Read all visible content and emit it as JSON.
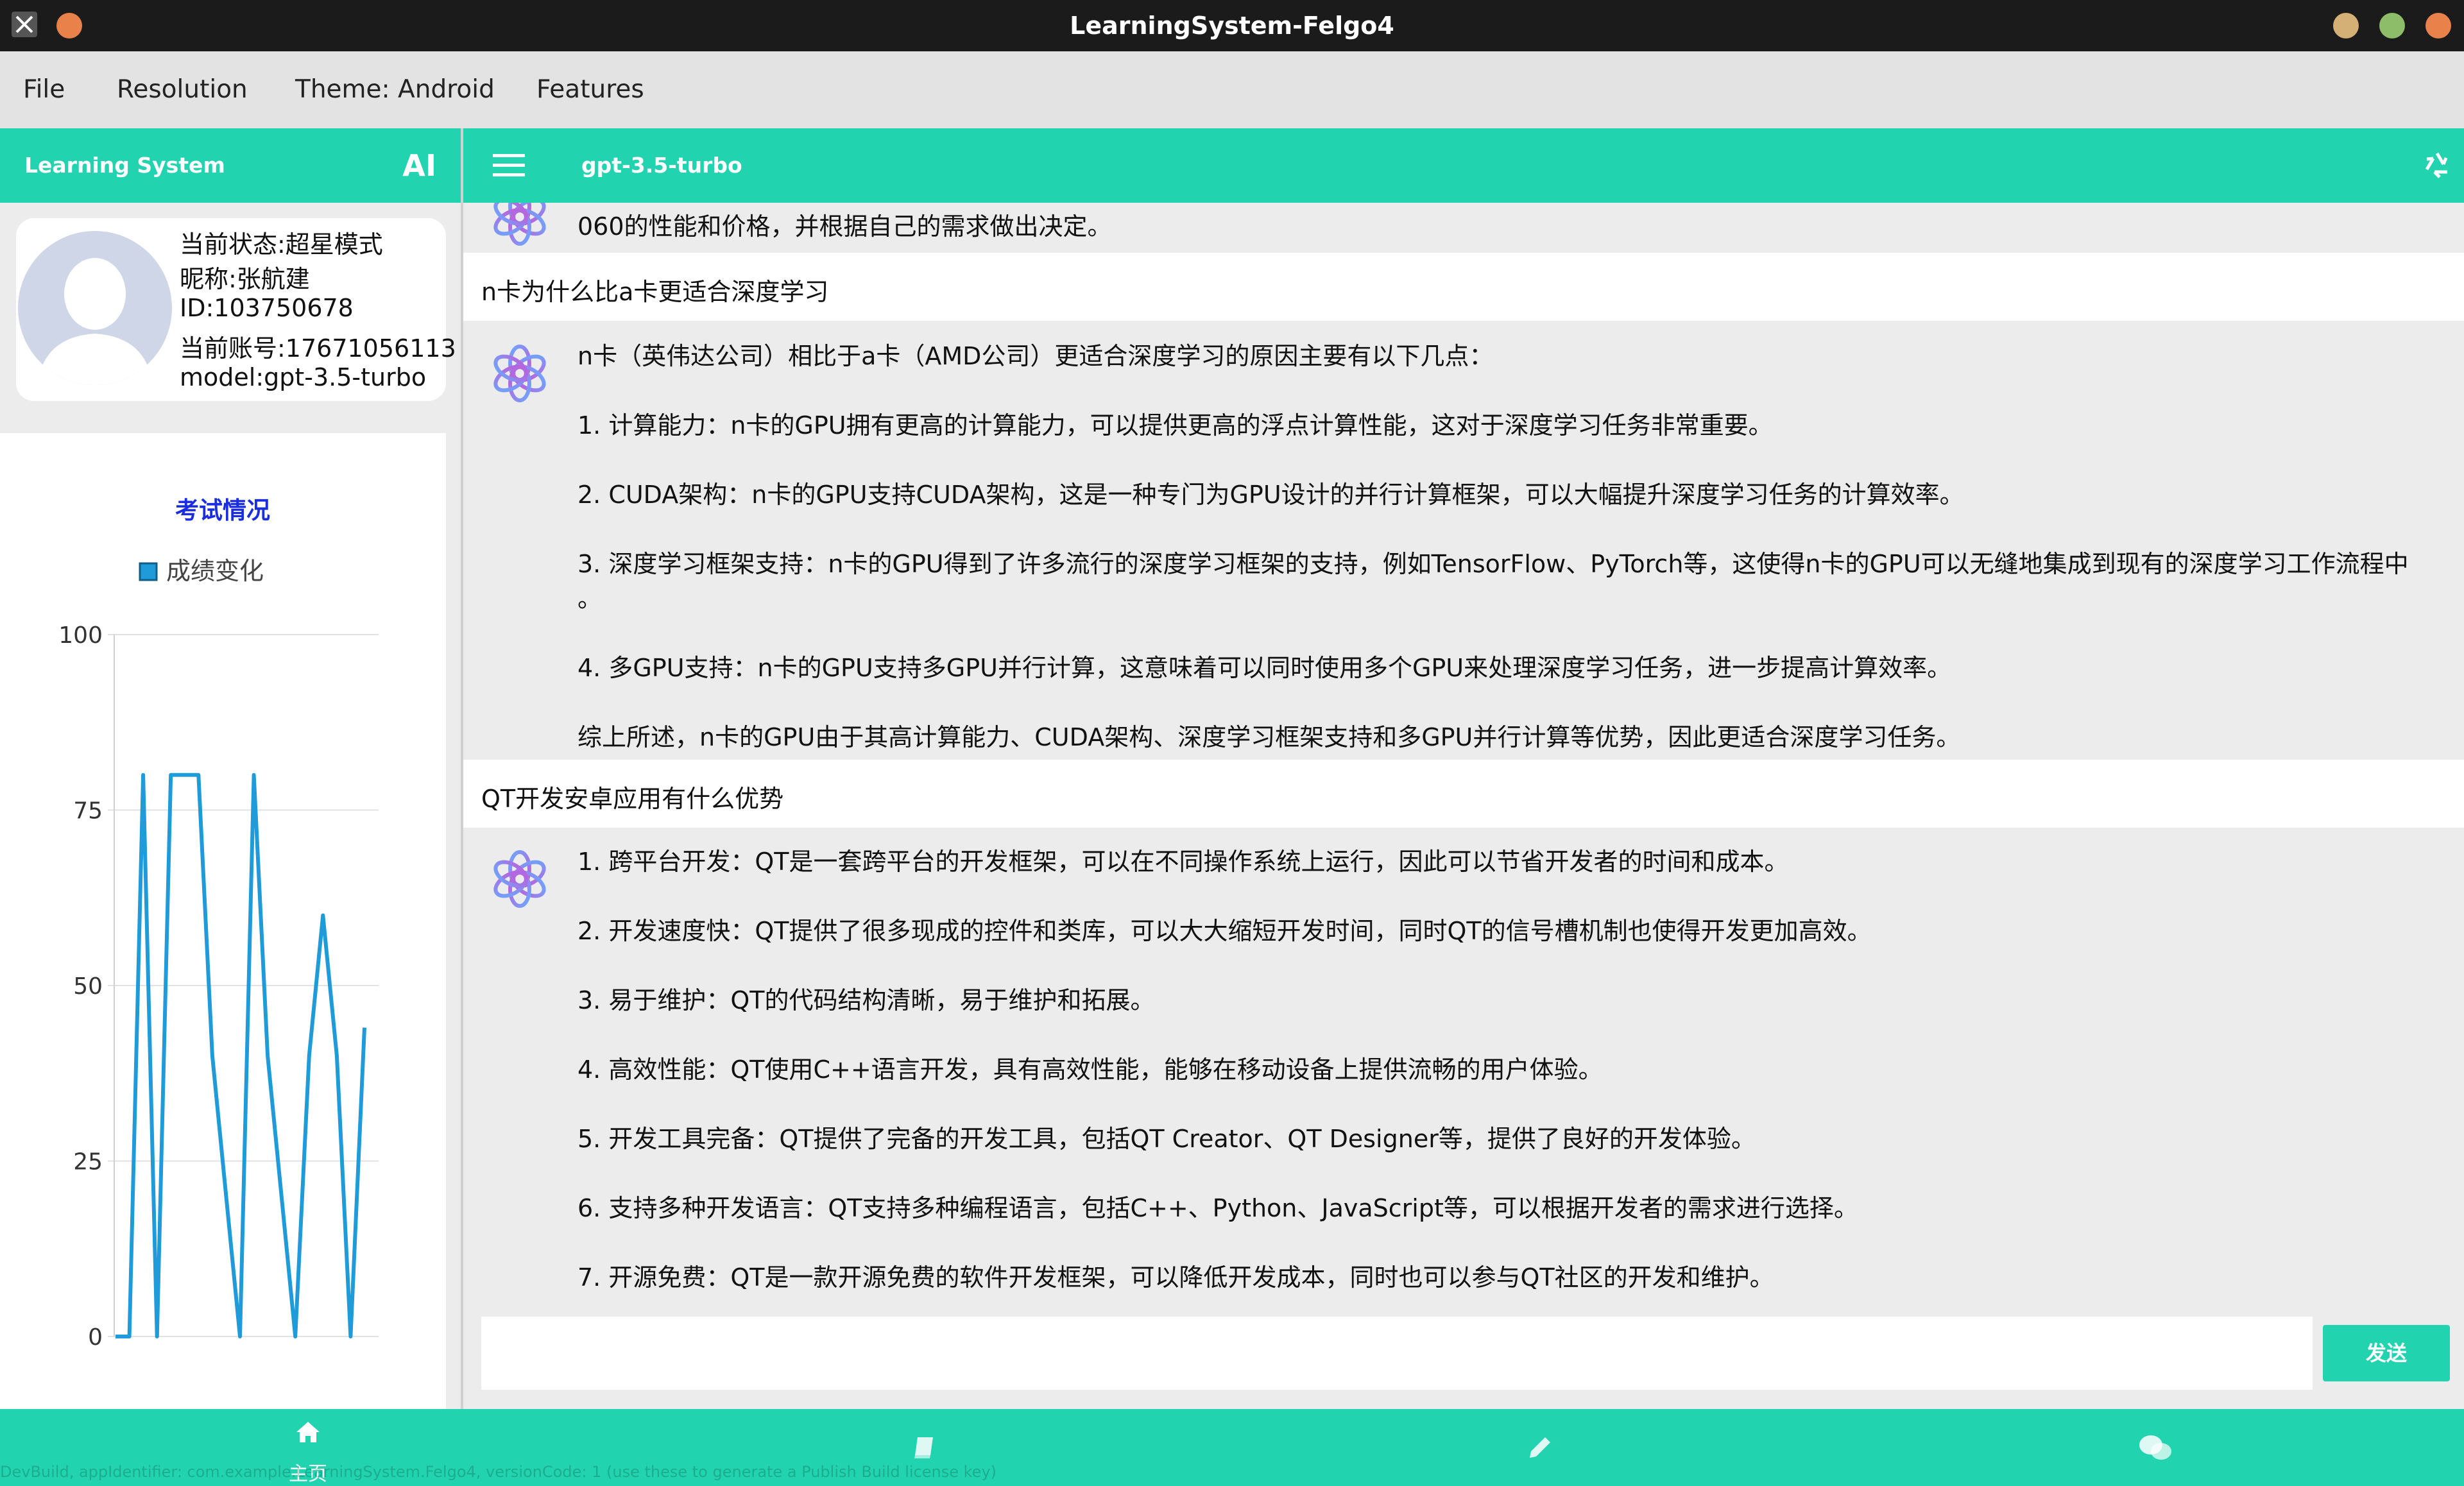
{
  "window": {
    "title": "LearningSystem-Felgo4"
  },
  "menu": {
    "file": "File",
    "resolution": "Resolution",
    "theme": "Theme: Android",
    "features": "Features"
  },
  "sidebar": {
    "app_title": "Learning System",
    "ai_label": "AI"
  },
  "main_toolbar": {
    "model_title": "gpt-3.5-turbo"
  },
  "profile": {
    "status": "当前状态:超星模式",
    "nickname": "昵称:张航建",
    "id": "ID:103750678",
    "account": "当前账号:17671056113",
    "model": "model:gpt-3.5-turbo"
  },
  "chart_data": {
    "type": "line",
    "title": "考试情况",
    "legend": [
      "成绩变化"
    ],
    "series": [
      {
        "name": "成绩变化",
        "color": "#1e9bd8",
        "values": [
          0,
          0,
          80,
          0,
          80,
          80,
          80,
          40,
          20,
          0,
          80,
          40,
          20,
          0,
          40,
          60,
          40,
          0,
          44
        ]
      }
    ],
    "yticks": [
      "100",
      "75",
      "50",
      "25",
      "0"
    ],
    "ylim": [
      0,
      100
    ],
    "grid": true,
    "legend_position": "top"
  },
  "chat": {
    "messages": [
      {
        "role": "assistant",
        "lines": [
          "060的性能和价格，并根据自己的需求做出决定。"
        ]
      },
      {
        "role": "user",
        "text": "n卡为什么比a卡更适合深度学习"
      },
      {
        "role": "assistant",
        "lines": [
          "n卡（英伟达公司）相比于a卡（AMD公司）更适合深度学习的原因主要有以下几点：",
          "1. 计算能力：n卡的GPU拥有更高的计算能力，可以提供更高的浮点计算性能，这对于深度学习任务非常重要。",
          "2. CUDA架构：n卡的GPU支持CUDA架构，这是一种专门为GPU设计的并行计算框架，可以大幅提升深度学习任务的计算效率。",
          "3. 深度学习框架支持：n卡的GPU得到了许多流行的深度学习框架的支持，例如TensorFlow、PyTorch等，这使得n卡的GPU可以无缝地集成到现有的深度学习工作流程中",
          "。",
          "4. 多GPU支持：n卡的GPU支持多GPU并行计算，这意味着可以同时使用多个GPU来处理深度学习任务，进一步提高计算效率。",
          "综上所述，n卡的GPU由于其高计算能力、CUDA架构、深度学习框架支持和多GPU并行计算等优势，因此更适合深度学习任务。"
        ]
      },
      {
        "role": "user",
        "text": "QT开发安卓应用有什么优势"
      },
      {
        "role": "assistant",
        "lines": [
          "1. 跨平台开发：QT是一套跨平台的开发框架，可以在不同操作系统上运行，因此可以节省开发者的时间和成本。",
          "2. 开发速度快：QT提供了很多现成的控件和类库，可以大大缩短开发时间，同时QT的信号槽机制也使得开发更加高效。",
          "3. 易于维护：QT的代码结构清晰，易于维护和拓展。",
          "4. 高效性能：QT使用C++语言开发，具有高效性能，能够在移动设备上提供流畅的用户体验。",
          "5. 开发工具完备：QT提供了完备的开发工具，包括QT Creator、QT Designer等，提供了良好的开发体验。",
          "6. 支持多种开发语言：QT支持多种编程语言，包括C++、Python、JavaScript等，可以根据开发者的需求进行选择。",
          "7. 开源免费：QT是一款开源免费的软件开发框架，可以降低开发成本，同时也可以参与QT社区的开发和维护。"
        ]
      }
    ]
  },
  "input": {
    "placeholder": "",
    "send_label": "发送"
  },
  "bottom_nav": {
    "home_label": "主页"
  },
  "watermark": "DevBuild, appIdentifier: com.example.LearningSystem.Felgo4, versionCode: 1 (use these to generate a Publish Build license key)",
  "icons": {
    "menu": "hamburger-icon",
    "recycle": "recycle-icon",
    "home": "home-icon",
    "book": "book-icon",
    "pencil": "pencil-icon",
    "chat": "wechat-icon",
    "assistant": "openai-logo-icon"
  }
}
